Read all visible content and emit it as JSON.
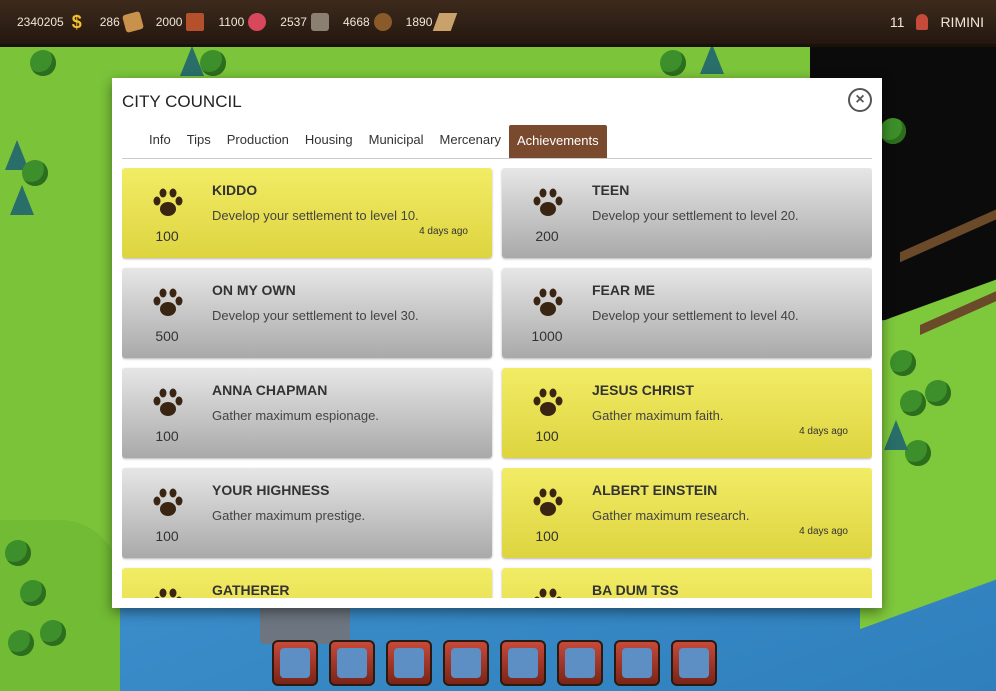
{
  "topbar": {
    "resources": [
      {
        "value": "2340205",
        "icon": "dollar-icon"
      },
      {
        "value": "286",
        "icon": "wood-icon"
      },
      {
        "value": "2000",
        "icon": "brick-icon"
      },
      {
        "value": "1100",
        "icon": "meat-icon"
      },
      {
        "value": "2537",
        "icon": "stone-icon"
      },
      {
        "value": "4668",
        "icon": "log-icon"
      },
      {
        "value": "1890",
        "icon": "plank-icon"
      }
    ],
    "level": "11",
    "city": "RIMINI"
  },
  "dialog": {
    "title": "CITY COUNCIL",
    "tabs": [
      {
        "label": "Info"
      },
      {
        "label": "Tips"
      },
      {
        "label": "Production"
      },
      {
        "label": "Housing"
      },
      {
        "label": "Municipal"
      },
      {
        "label": "Mercenary"
      },
      {
        "label": "Achievements"
      }
    ],
    "active_tab": "Achievements",
    "achievements": [
      {
        "title": "KIDDO",
        "desc": "Develop your settlement to level 10.",
        "points": "100",
        "date": "4 days ago",
        "state": "achieved"
      },
      {
        "title": "TEEN",
        "desc": "Develop your settlement to level 20.",
        "points": "200",
        "date": "",
        "state": "locked"
      },
      {
        "title": "ON MY OWN",
        "desc": "Develop your settlement to level 30.",
        "points": "500",
        "date": "",
        "state": "locked"
      },
      {
        "title": "FEAR ME",
        "desc": "Develop your settlement to level 40.",
        "points": "1000",
        "date": "",
        "state": "locked"
      },
      {
        "title": "ANNA CHAPMAN",
        "desc": "Gather maximum espionage.",
        "points": "100",
        "date": "",
        "state": "locked"
      },
      {
        "title": "JESUS CHRIST",
        "desc": "Gather maximum faith.",
        "points": "100",
        "date": "4 days ago",
        "state": "achieved"
      },
      {
        "title": "YOUR HIGHNESS",
        "desc": "Gather maximum prestige.",
        "points": "100",
        "date": "",
        "state": "locked"
      },
      {
        "title": "ALBERT EINSTEIN",
        "desc": "Gather maximum research.",
        "points": "100",
        "date": "4 days ago",
        "state": "achieved"
      },
      {
        "title": "GATHERER",
        "desc": "",
        "points": "",
        "date": "",
        "state": "achieved"
      },
      {
        "title": "BA DUM TSS",
        "desc": "",
        "points": "",
        "date": "",
        "state": "achieved"
      }
    ]
  },
  "bottom_bar": {
    "buttons": [
      "house-icon",
      "bank-icon",
      "market-icon",
      "academy-icon",
      "glove-icon",
      "book-icon",
      "church-icon",
      "tavern-icon"
    ]
  },
  "colors": {
    "achieved": "#eee85a",
    "locked": "#c8c8c8",
    "active_tab": "#7a4a2f",
    "topbar": "#2f2015"
  }
}
